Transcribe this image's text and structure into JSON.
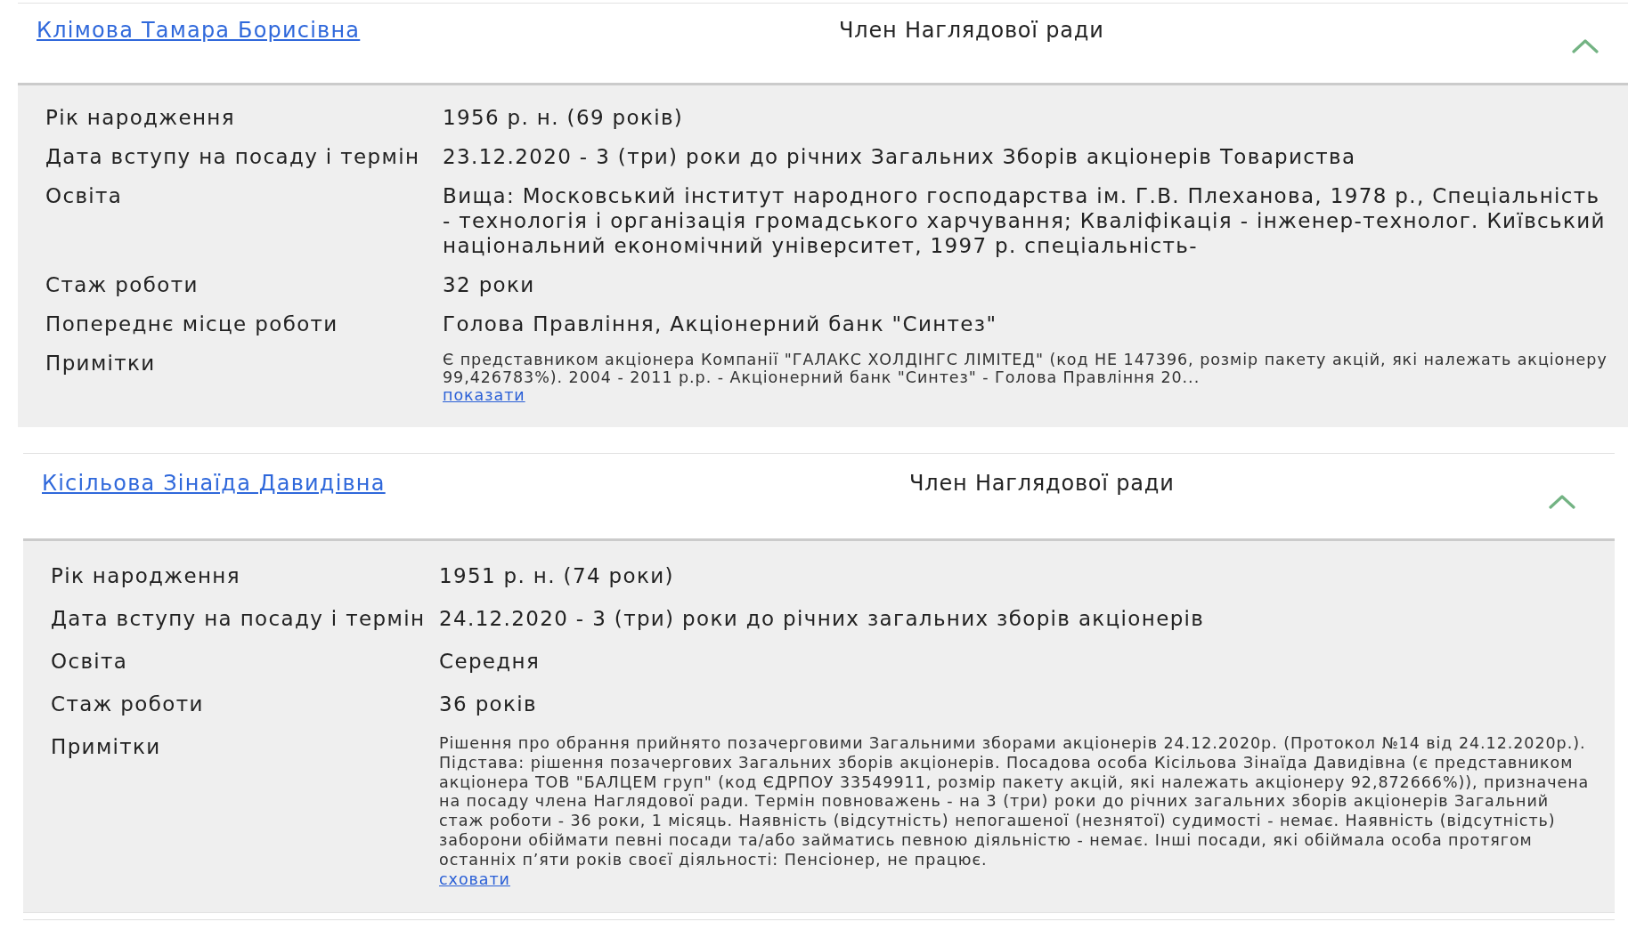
{
  "members": [
    {
      "name": "Клімова Тамара Борисівна",
      "position": "Член Наглядової ради",
      "expanded": true,
      "details": [
        {
          "label": "Рік народження",
          "value": "1956 р. н. (69 років)"
        },
        {
          "label": "Дата вступу на посаду і термін",
          "value": "23.12.2020 - 3 (три) роки до річних Загальних Зборів акціонерів Товариства"
        },
        {
          "label": "Освіта",
          "value": "Вища: Московський інститут народного господарства ім. Г.В. Плеханова, 1978 р., Спеціальність - технологія і організація громадського харчування; Кваліфікація - інженер-технолог. Київський національний економічний університет, 1997 р. спеціальність-"
        },
        {
          "label": "Стаж роботи",
          "value": "32 роки"
        },
        {
          "label": "Попереднє місце роботи",
          "value": "Голова Правління, Акціонерний банк \"Синтез\""
        }
      ],
      "notes": {
        "label": "Примітки",
        "text": "Є представником акціонера Компанії \"ГАЛАКС ХОЛДІНГС ЛІМІТЕД\" (код НЕ 147396, розмір пакету акцій, які належать акціонеру 99,426783%). 2004 - 2011 р.р. - Акціонерний банк \"Синтез\" - Голова Правління 20...",
        "toggle": "показати"
      }
    },
    {
      "name": "Кісільова Зінаїда Давидівна",
      "position": "Член Наглядової ради",
      "expanded": true,
      "details": [
        {
          "label": "Рік народження",
          "value": "1951 р. н. (74 роки)"
        },
        {
          "label": "Дата вступу на посаду і термін",
          "value": "24.12.2020 - 3 (три) роки до річних загальних зборів акціонерів"
        },
        {
          "label": "Освіта",
          "value": "Середня"
        },
        {
          "label": "Стаж роботи",
          "value": "36 років"
        }
      ],
      "notes": {
        "label": "Примітки",
        "text": "Рішення про обрання прийнято позачерговими Загальними зборами акціонерів 24.12.2020р. (Протокол №14 від 24.12.2020р.). Підстава: рішення позачергових Загальних зборів акціонерів. Посадова особа Кісільова Зінаїда Давидівна (є представником акціонера ТОВ \"БАЛЦЕМ груп\" (код ЄДРПОУ 33549911, розмір пакету акцій, які належать акціонеру 92,872666%)), призначена на посаду члена Наглядової ради. Термін повноважень - на 3 (три) роки до річних загальних зборів акціонерів Загальний стаж роботи - 36 роки, 1 місяць. Наявність (відсутність) непогашеної (незнятої) судимості - немає. Наявність (відсутність) заборони обіймати певні посади та/або займатись певною діяльністю - немає. Інші посади, які обіймала особа протягом останніх п’яти років своєї діяльності: Пенсіонер, не працює.",
        "toggle": "сховати"
      }
    }
  ]
}
